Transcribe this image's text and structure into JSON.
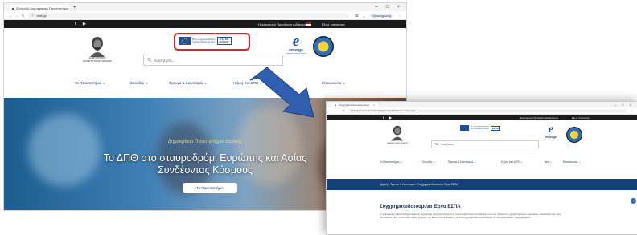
{
  "screen_a": {
    "browser": {
      "tab_title": "Ελληνικό Δημοκρατικό Πανεπιστήμιο",
      "url": "duth.gr",
      "profile_button": "Ολοκλήρωση"
    },
    "topbar": {
      "social": [
        "f",
        "▶"
      ],
      "links": [
        "Ηλεκτρονική Πρόσβαση Διδάσκοντα",
        "Εξωτ. Ιστότοπος"
      ]
    },
    "logo_text": "ΔΗΜΟΚΡΙΤΕΙΟ ΠΑΝΕΠΙΣΤΗΜΙΟ ΘΡΑΚΗΣ",
    "search_placeholder": "Αναζήτηση...",
    "espa": {
      "eu_text_1": "Με τη συγχρηματοδότηση",
      "eu_text_2": "της Ευρωπαϊκής Ένωσης",
      "logo": "ΕΣΠΑ",
      "logo_sub": "2021-2027"
    },
    "emerge": {
      "mark": "e",
      "name": "emerge",
      "sub": "european university alliance"
    },
    "nav": [
      "Το Πανεπιστήμιο ⌄",
      "Σπουδές ⌄",
      "Έρευνα & Καινοτομία ⌄",
      "Η ζωή στο ΔΠΘ ⌄",
      "Επικοινωνία ⌄"
    ],
    "hero": {
      "kicker": "Δημοκρίτειο Πανεπιστήμιο Θράκης",
      "title_line1": "Το ΔΠΘ στο σταυροδρόμι Ευρώπης και Ασίας",
      "title_line2": "Συνδέοντας Κόσμους",
      "button": "Το Πανεπιστήμιο"
    }
  },
  "screen_b": {
    "browser": {
      "tab_title": "Συγχρηματοδοτούμενα Έργα",
      "url": "duth.gr/erevna-kainotomia/sygxrimatodotoumena-erga-espa"
    },
    "topbar": {
      "social": [
        "f",
        "▶"
      ],
      "links": [
        "Ηλεκτρονική Πρόσβαση Διδάσκοντα",
        "Εξωτ. Ιστότοπος"
      ]
    },
    "search_placeholder": "Αναζήτηση...",
    "nav": [
      "Το Πανεπιστήμιο ⌄",
      "Σπουδές ⌄",
      "Έρευνα & Καινοτομία ⌄",
      "Η ζωή στο ΔΠΘ ⌄",
      "Νέα ⌄",
      "Επικοινωνία ⌄"
    ],
    "breadcrumb": "Αρχική > Έρευνα & Καινοτομία > Συγχρηματοδοτούμενα Έργα ΕΣΠΑ",
    "section_title": "Συγχρηματοδοτούμενα Έργα ΕΣΠΑ",
    "paragraph": "Το Δημοκρίτειο Πανεπιστήμιο Θράκης συμμετέχει στην υλοποίηση των αποτελεσματικών επενδύσεων και των υπολοίπων χρηματοδοτικών εργαλείων, ακολουθώντας τους κανονισμούς και τις κατευθυντήριες γραμμές της Ευρωπαϊκής Ένωσης για τα συγχρηματοδοτούμενα έργα του Επιχειρησιακού Προγράμματος."
  },
  "colors": {
    "highlight": "#e02020",
    "arrow": "#2f5fae",
    "navy": "#16407a",
    "topbar": "#1b1b1b"
  }
}
